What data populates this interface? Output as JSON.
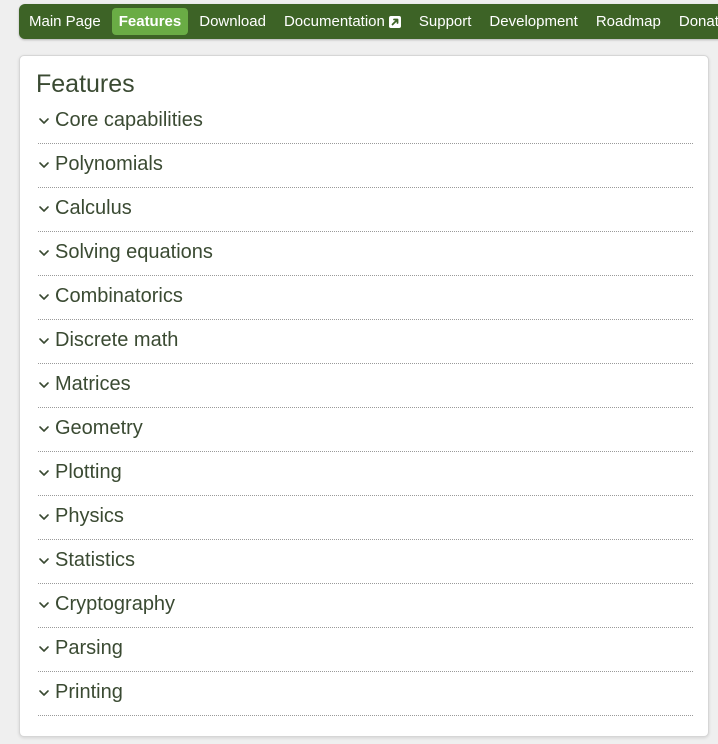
{
  "nav": {
    "items": [
      {
        "label": "Main Page"
      },
      {
        "label": "Features"
      },
      {
        "label": "Download"
      },
      {
        "label": "Documentation"
      },
      {
        "label": "Support"
      },
      {
        "label": "Development"
      },
      {
        "label": "Roadmap"
      },
      {
        "label": "Donate"
      }
    ],
    "active_item": "Features",
    "external_link_icon": "external-link-icon"
  },
  "main": {
    "title": "Features",
    "sections": [
      {
        "label": "Core capabilities"
      },
      {
        "label": "Polynomials"
      },
      {
        "label": "Calculus"
      },
      {
        "label": "Solving equations"
      },
      {
        "label": "Combinatorics"
      },
      {
        "label": "Discrete math"
      },
      {
        "label": "Matrices"
      },
      {
        "label": "Geometry"
      },
      {
        "label": "Plotting"
      },
      {
        "label": "Physics"
      },
      {
        "label": "Statistics"
      },
      {
        "label": "Cryptography"
      },
      {
        "label": "Parsing"
      },
      {
        "label": "Printing"
      }
    ],
    "section_icon": "chevron-down-icon"
  },
  "colors": {
    "nav_background": "#3d6326",
    "nav_active": "#6aac45",
    "text": "#3a4a32",
    "page_background": "#efefef"
  }
}
